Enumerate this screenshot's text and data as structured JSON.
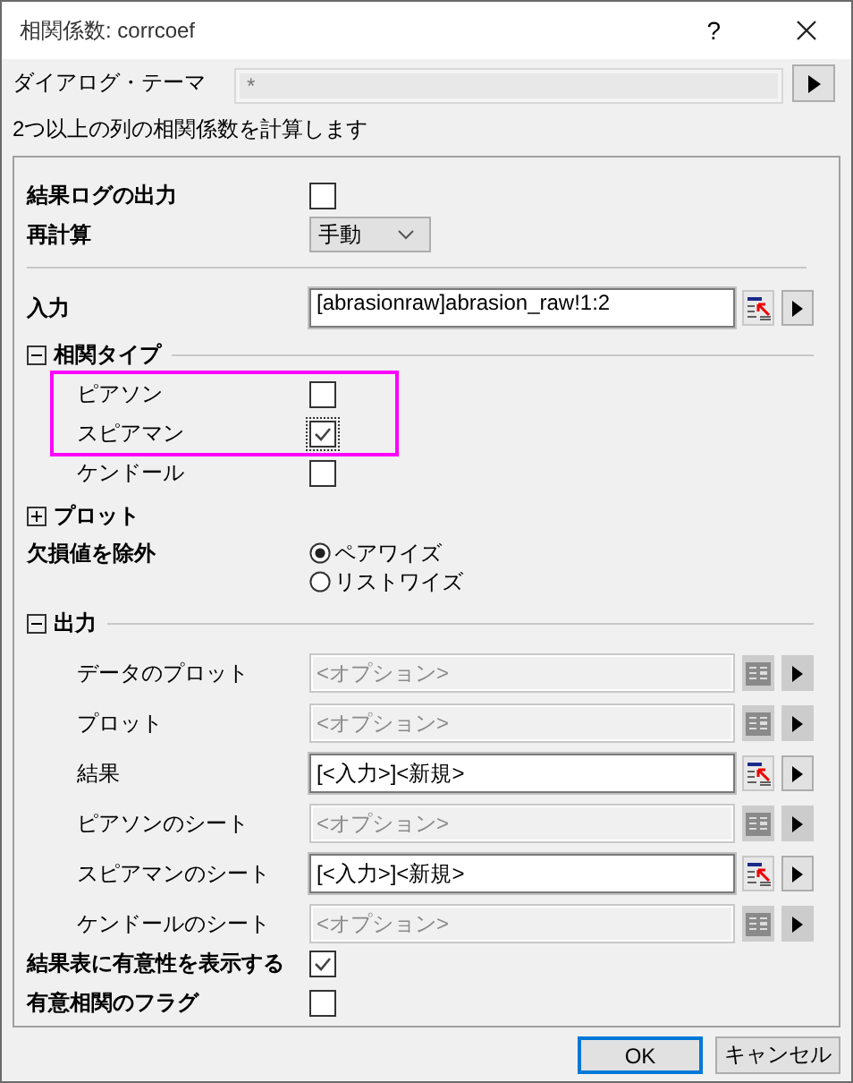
{
  "window": {
    "title": "相関係数: corrcoef",
    "help": "?"
  },
  "theme": {
    "label": "ダイアログ・テーマ",
    "value": "*"
  },
  "description": "2つ以上の列の相関係数を計算します",
  "output_log": {
    "label": "結果ログの出力",
    "checked": false
  },
  "recalculate": {
    "label": "再計算",
    "value": "手動"
  },
  "input": {
    "label": "入力",
    "value": "[abrasionraw]abrasion_raw!1:2"
  },
  "correlation_type": {
    "label": "相関タイプ",
    "expanded": true,
    "items": [
      {
        "label": "ピアソン",
        "checked": false,
        "highlighted": true
      },
      {
        "label": "スピアマン",
        "checked": true,
        "highlighted": true
      },
      {
        "label": "ケンドール",
        "checked": false,
        "highlighted": false
      }
    ]
  },
  "plot": {
    "label": "プロット",
    "expanded": false
  },
  "exclude_missing": {
    "label": "欠損値を除外",
    "options": [
      {
        "label": "ペアワイズ",
        "selected": true
      },
      {
        "label": "リストワイズ",
        "selected": false
      }
    ]
  },
  "output": {
    "label": "出力",
    "expanded": true,
    "items": [
      {
        "label": "データのプロット",
        "placeholder": "<オプション>",
        "disabled": true
      },
      {
        "label": "プロット",
        "placeholder": "<オプション>",
        "disabled": true
      },
      {
        "label": "結果",
        "value": "[<入力>]<新規>",
        "disabled": false
      },
      {
        "label": "ピアソンのシート",
        "placeholder": "<オプション>",
        "disabled": true
      },
      {
        "label": "スピアマンのシート",
        "value": "[<入力>]<新規>",
        "disabled": false
      },
      {
        "label": "ケンドールのシート",
        "placeholder": "<オプション>",
        "disabled": true
      }
    ]
  },
  "show_significance": {
    "label": "結果表に有意性を表示する",
    "checked": true
  },
  "flag_significant": {
    "label": "有意相関のフラグ",
    "checked": false
  },
  "buttons": [
    {
      "label": "OK",
      "default": true
    },
    {
      "label": "キャンセル",
      "default": false
    }
  ]
}
